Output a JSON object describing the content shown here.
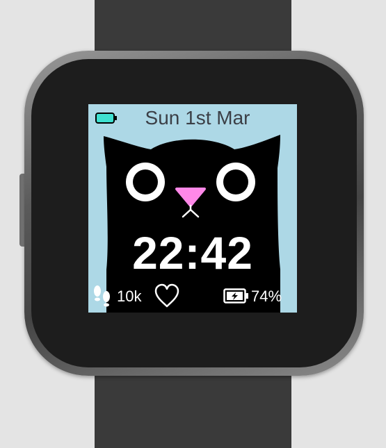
{
  "watchface": {
    "date": "Sun 1st Mar",
    "time": "22:42",
    "steps": "10k",
    "battery": "74%"
  },
  "icons": {
    "top_battery": "battery-icon",
    "steps": "footsteps-icon",
    "heart": "heart-icon",
    "battery": "battery-charging-icon"
  },
  "colors": {
    "sky": "#add8e6",
    "cat": "#000000",
    "nose": "#ff88e8",
    "battery_fill": "#3fe0d0"
  }
}
